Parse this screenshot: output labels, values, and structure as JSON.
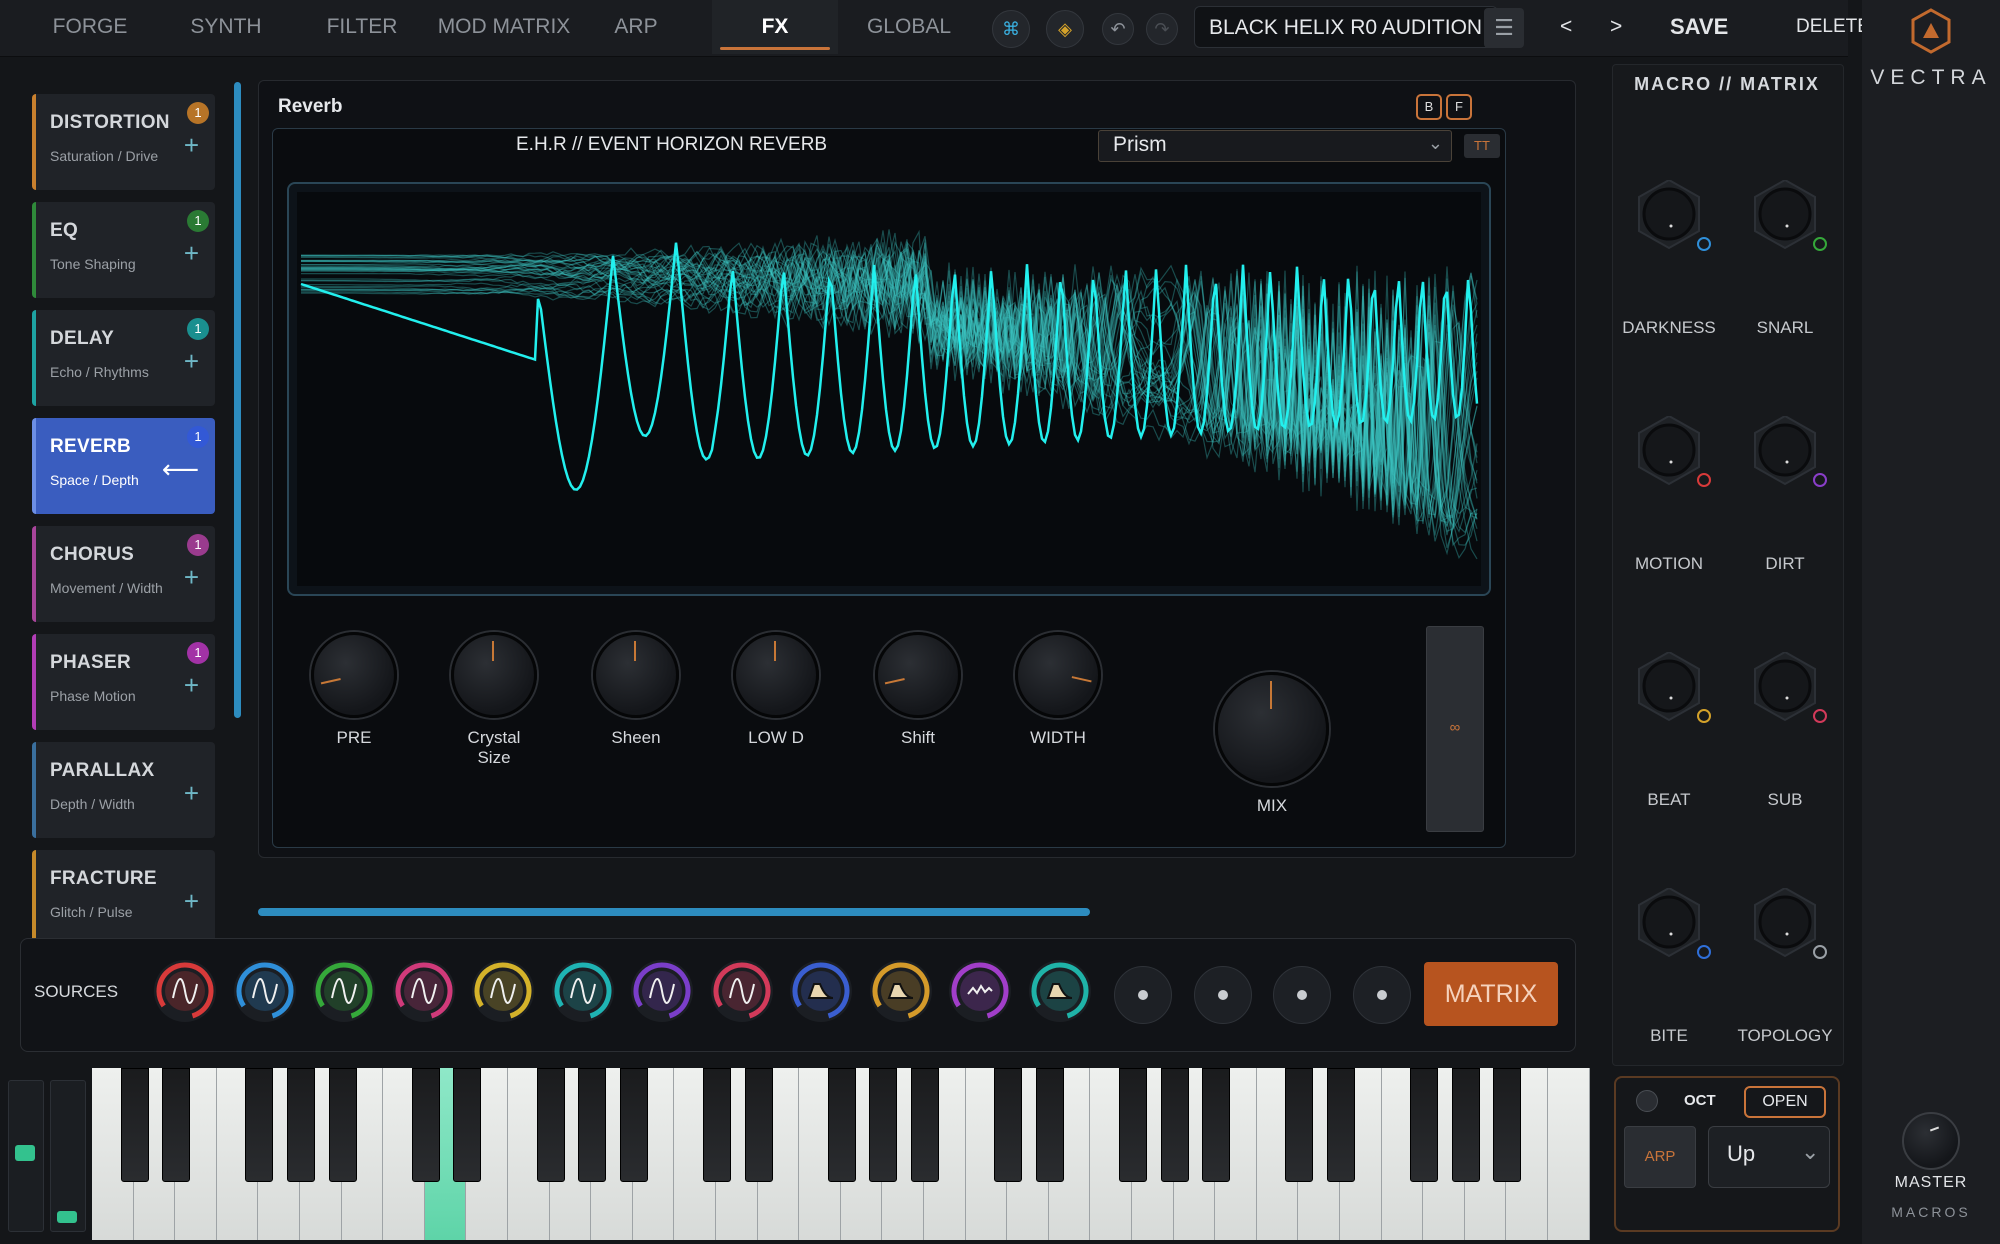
{
  "tabs": [
    "FORGE",
    "SYNTH",
    "FILTER",
    "MOD MATRIX",
    "ARP",
    "FX",
    "GLOBAL"
  ],
  "active_tab": "FX",
  "preset": {
    "name": "BLACK HELIX R0 AUDITION",
    "prev": "<",
    "next": ">",
    "save": "SAVE",
    "delete": "DELETE"
  },
  "brand": {
    "name": "VECTRA",
    "master": "MASTER",
    "macros": "MACROS"
  },
  "fx_list": [
    {
      "title": "DISTORTION",
      "sub": "Saturation / Drive",
      "badge": "1",
      "color": "#c9802e",
      "badge_color": "#b77427"
    },
    {
      "title": "EQ",
      "sub": "Tone Shaping",
      "badge": "1",
      "color": "#2f8a3a",
      "badge_color": "#2a7a34"
    },
    {
      "title": "DELAY",
      "sub": "Echo / Rhythms",
      "badge": "1",
      "color": "#1ea3a3",
      "badge_color": "#1a8f8f"
    },
    {
      "title": "REVERB",
      "sub": "Space / Depth",
      "badge": "1",
      "color": "#6c8fe6",
      "badge_color": "#3359d6"
    },
    {
      "title": "CHORUS",
      "sub": "Movement / Width",
      "badge": "1",
      "color": "#a8459b",
      "badge_color": "#9a3b8e"
    },
    {
      "title": "PHASER",
      "sub": "Phase Motion",
      "badge": "1",
      "color": "#b23db6",
      "badge_color": "#a232a6"
    },
    {
      "title": "PARALLAX",
      "sub": "Depth / Width",
      "badge": "",
      "color": "#3a6f9d",
      "badge_color": ""
    },
    {
      "title": "FRACTURE",
      "sub": "Glitch / Pulse",
      "badge": "",
      "color": "#c68a2a",
      "badge_color": ""
    }
  ],
  "panel": {
    "title": "Reverb",
    "b": "B",
    "f": "F",
    "algo": "E.H.R  //  EVENT HORIZON REVERB",
    "mode": "Prism",
    "tt": "TT"
  },
  "knobs": [
    {
      "label": "PRE",
      "value": 0.12
    },
    {
      "label": "Crystal Size",
      "value": 0.5
    },
    {
      "label": "Sheen",
      "value": 0.5
    },
    {
      "label": "LOW D",
      "value": 0.5
    },
    {
      "label": "Shift",
      "value": 0.12
    },
    {
      "label": "WIDTH",
      "value": 0.88
    }
  ],
  "mix": {
    "label": "MIX",
    "value": 0.5
  },
  "freeze": {
    "symbol": "∞"
  },
  "sources": {
    "label": "SOURCES",
    "matrix": "MATRIX",
    "items": [
      {
        "color": "#d83a3a",
        "shape": "sine",
        "amount": 0.8
      },
      {
        "color": "#2f8fd9",
        "shape": "sine",
        "amount": 0.8
      },
      {
        "color": "#35a83a",
        "shape": "sine",
        "amount": 0.8
      },
      {
        "color": "#d03a7a",
        "shape": "sine",
        "amount": 0.8
      },
      {
        "color": "#d4b22a",
        "shape": "sine",
        "amount": 0.8
      },
      {
        "color": "#1fb3b3",
        "shape": "sine",
        "amount": 0.8
      },
      {
        "color": "#7a3ec9",
        "shape": "sine",
        "amount": 0.8
      },
      {
        "color": "#d23a5a",
        "shape": "sine",
        "amount": 0.8
      },
      {
        "color": "#3a5ed0",
        "shape": "env",
        "amount": 0.8
      },
      {
        "color": "#d49a2a",
        "shape": "env",
        "amount": 0.8
      },
      {
        "color": "#a13ec9",
        "shape": "noise",
        "amount": 0.8
      },
      {
        "color": "#1fb3a8",
        "shape": "env",
        "amount": 0.8
      }
    ],
    "empty_slots": 4
  },
  "macro": {
    "title": "MACRO // MATRIX",
    "items": [
      {
        "label": "DARKNESS",
        "dot": "#2f8fd9"
      },
      {
        "label": "SNARL",
        "dot": "#35a83a"
      },
      {
        "label": "MOTION",
        "dot": "#d83a3a"
      },
      {
        "label": "DIRT",
        "dot": "#8a3ec9"
      },
      {
        "label": "BEAT",
        "dot": "#d4a22a"
      },
      {
        "label": "SUB",
        "dot": "#d23a5a"
      },
      {
        "label": "BITE",
        "dot": "#2f6fd9"
      },
      {
        "label": "TOPOLOGY",
        "dot": "#9aa0a6"
      }
    ]
  },
  "arp": {
    "oct": "OCT",
    "open": "OPEN",
    "arp": "ARP",
    "direction": "Up"
  }
}
